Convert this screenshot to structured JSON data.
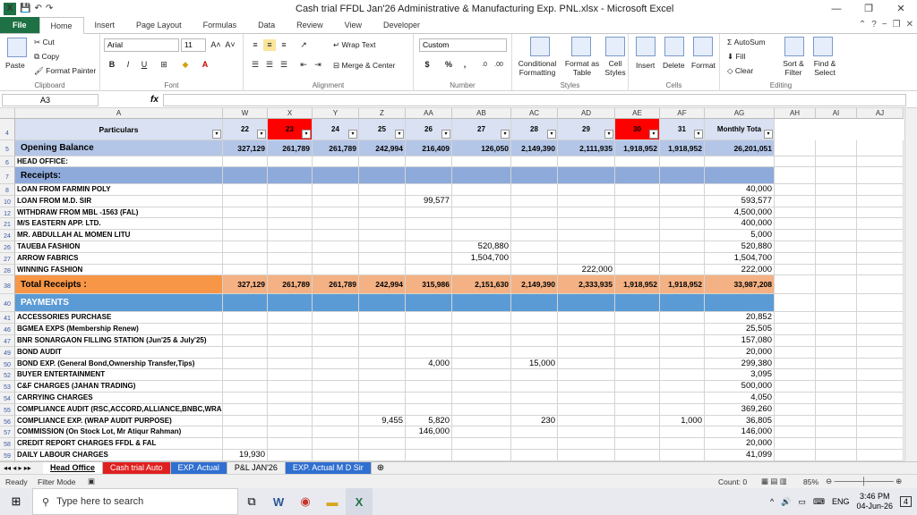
{
  "window": {
    "title": "Cash trial FFDL Jan'26 Administrative & Manufacturing Exp. PNL.xlsx  -  Microsoft Excel",
    "minimize": "—",
    "restore": "❐",
    "close": "✕"
  },
  "tabs": [
    "File",
    "Home",
    "Insert",
    "Page Layout",
    "Formulas",
    "Data",
    "Review",
    "View",
    "Developer"
  ],
  "ribbon": {
    "clipboard": {
      "paste": "Paste",
      "cut": "Cut",
      "copy": "Copy",
      "format_painter": "Format Painter",
      "label": "Clipboard"
    },
    "font": {
      "name": "Arial",
      "size": "11",
      "bold": "B",
      "italic": "I",
      "underline": "U",
      "grow": "A˄",
      "shrink": "A˅",
      "label": "Font"
    },
    "alignment": {
      "wrap": "Wrap Text",
      "merge": "Merge & Center",
      "label": "Alignment"
    },
    "number": {
      "format": "Custom",
      "currency": "$",
      "percent": "%",
      "comma": ",",
      "label": "Number"
    },
    "styles": {
      "cond": "Conditional Formatting",
      "table": "Format as Table",
      "cell": "Cell Styles",
      "label": "Styles"
    },
    "cells": {
      "insert": "Insert",
      "delete": "Delete",
      "format": "Format",
      "label": "Cells"
    },
    "editing": {
      "autosum": "AutoSum",
      "fill": "Fill",
      "clear": "Clear",
      "sort": "Sort & Filter",
      "find": "Find & Select",
      "label": "Editing"
    }
  },
  "formula_bar": {
    "name_box": "A3",
    "fx": "fx",
    "value": ""
  },
  "columns": [
    "A",
    "W",
    "X",
    "Y",
    "Z",
    "AA",
    "AB",
    "AC",
    "AD",
    "AE",
    "AF",
    "AG",
    "AH",
    "AI",
    "AJ"
  ],
  "header_row": {
    "row": "4",
    "particulars": "Particulars",
    "days": [
      "22",
      "23",
      "24",
      "25",
      "26",
      "27",
      "28",
      "29",
      "30",
      "31"
    ],
    "total": "Monthly Tota"
  },
  "rows": [
    {
      "r": "5",
      "label": "Opening Balance",
      "vals": [
        "327,129",
        "261,789",
        "261,789",
        "242,994",
        "216,409",
        "126,050",
        "2,149,390",
        "2,111,935",
        "1,918,952",
        "1,918,952"
      ],
      "total": "26,201,051",
      "style": "opening"
    },
    {
      "r": "6",
      "label": "HEAD OFFICE:",
      "vals": [
        "",
        "",
        "",
        "",
        "",
        "",
        "",
        "",
        "",
        ""
      ],
      "total": "",
      "style": "plainbold"
    },
    {
      "r": "7",
      "label": "Receipts:",
      "vals": [
        "",
        "",
        "",
        "",
        "",
        "",
        "",
        "",
        "",
        ""
      ],
      "total": "",
      "style": "section"
    },
    {
      "r": "8",
      "label": "LOAN FROM FARMIN POLY",
      "vals": [
        "",
        "",
        "",
        "",
        "",
        "",
        "",
        "",
        "",
        ""
      ],
      "total": "40,000",
      "style": "item"
    },
    {
      "r": "10",
      "label": "LOAN FROM M.D. SIR",
      "vals": [
        "",
        "",
        "",
        "",
        "99,577",
        "",
        "",
        "",
        "",
        ""
      ],
      "total": "593,577",
      "style": "item"
    },
    {
      "r": "12",
      "label": "WITHDRAW FROM MBL -1563 (FAL)",
      "vals": [
        "",
        "",
        "",
        "",
        "",
        "",
        "",
        "",
        "",
        ""
      ],
      "total": "4,500,000",
      "style": "item"
    },
    {
      "r": "21",
      "label": "M/S EASTERN APP. LTD.",
      "vals": [
        "",
        "",
        "",
        "",
        "",
        "",
        "",
        "",
        "",
        ""
      ],
      "total": "400,000",
      "style": "item"
    },
    {
      "r": "24",
      "label": "MR. ABDULLAH AL MOMEN LITU",
      "vals": [
        "",
        "",
        "",
        "",
        "",
        "",
        "",
        "",
        "",
        ""
      ],
      "total": "5,000",
      "style": "item"
    },
    {
      "r": "26",
      "label": "TAUEBA FASHION",
      "vals": [
        "",
        "",
        "",
        "",
        "",
        "520,880",
        "",
        "",
        "",
        ""
      ],
      "total": "520,880",
      "style": "item"
    },
    {
      "r": "27",
      "label": "ARROW FABRICS",
      "vals": [
        "",
        "",
        "",
        "",
        "",
        "1,504,700",
        "",
        "",
        "",
        ""
      ],
      "total": "1,504,700",
      "style": "item"
    },
    {
      "r": "28",
      "label": "WINNING FASHION",
      "vals": [
        "",
        "",
        "",
        "",
        "",
        "",
        "",
        "222,000",
        "",
        ""
      ],
      "total": "222,000",
      "style": "item"
    },
    {
      "r": "38",
      "label": "Total Receipts :",
      "vals": [
        "327,129",
        "261,789",
        "261,789",
        "242,994",
        "315,986",
        "2,151,630",
        "2,149,390",
        "2,333,935",
        "1,918,952",
        "1,918,952"
      ],
      "total": "33,987,208",
      "style": "total"
    },
    {
      "r": "40",
      "label": "PAYMENTS",
      "vals": [
        "",
        "",
        "",
        "",
        "",
        "",
        "",
        "",
        "",
        ""
      ],
      "total": "",
      "style": "payments"
    },
    {
      "r": "41",
      "label": "ACCESSORIES PURCHASE",
      "vals": [
        "",
        "",
        "",
        "",
        "",
        "",
        "",
        "",
        "",
        ""
      ],
      "total": "20,852",
      "style": "item"
    },
    {
      "r": "46",
      "label": "BGMEA EXPS (Membership Renew)",
      "vals": [
        "",
        "",
        "",
        "",
        "",
        "",
        "",
        "",
        "",
        ""
      ],
      "total": "25,505",
      "style": "item"
    },
    {
      "r": "47",
      "label": "BNR SONARGAON FILLING STATION (Jun'25 & July'25)",
      "vals": [
        "",
        "",
        "",
        "",
        "",
        "",
        "",
        "",
        "",
        ""
      ],
      "total": "157,080",
      "style": "item"
    },
    {
      "r": "49",
      "label": "BOND AUDIT",
      "vals": [
        "",
        "",
        "",
        "",
        "",
        "",
        "",
        "",
        "",
        ""
      ],
      "total": "20,000",
      "style": "item"
    },
    {
      "r": "50",
      "label": "BOND EXP. (General Bond,Ownership Transfer,Tips)",
      "vals": [
        "",
        "",
        "",
        "",
        "4,000",
        "",
        "15,000",
        "",
        "",
        ""
      ],
      "total": "299,380",
      "style": "item"
    },
    {
      "r": "52",
      "label": "BUYER ENTERTAINMENT",
      "vals": [
        "",
        "",
        "",
        "",
        "",
        "",
        "",
        "",
        "",
        ""
      ],
      "total": "3,095",
      "style": "item"
    },
    {
      "r": "53",
      "label": "C&F CHARGES (JAHAN TRADING)",
      "vals": [
        "",
        "",
        "",
        "",
        "",
        "",
        "",
        "",
        "",
        ""
      ],
      "total": "500,000",
      "style": "item"
    },
    {
      "r": "54",
      "label": "CARRYING CHARGES",
      "vals": [
        "",
        "",
        "",
        "",
        "",
        "",
        "",
        "",
        "",
        ""
      ],
      "total": "4,050",
      "style": "item"
    },
    {
      "r": "55",
      "label": "COMPLIANCE AUDIT (RSC,ACCORD,ALLIANCE,BNBC,WRAP)",
      "vals": [
        "",
        "",
        "",
        "",
        "",
        "",
        "",
        "",
        "",
        ""
      ],
      "total": "369,260",
      "style": "item"
    },
    {
      "r": "56",
      "label": "COMPLIANCE EXP. (WRAP AUDIT PURPOSE)",
      "vals": [
        "",
        "",
        "",
        "9,455",
        "5,820",
        "",
        "230",
        "",
        "",
        "1,000"
      ],
      "total": "36,805",
      "style": "item"
    },
    {
      "r": "57",
      "label": "COMMISSION (On Stock Lot, Mr Atiqur Rahman)",
      "vals": [
        "",
        "",
        "",
        "",
        "146,000",
        "",
        "",
        "",
        "",
        ""
      ],
      "total": "146,000",
      "style": "item"
    },
    {
      "r": "58",
      "label": "CREDIT REPORT CHARGES FFDL & FAL",
      "vals": [
        "",
        "",
        "",
        "",
        "",
        "",
        "",
        "",
        "",
        ""
      ],
      "total": "20,000",
      "style": "item"
    },
    {
      "r": "59",
      "label": "DAILY LABOUR CHARGES",
      "vals": [
        "19,930",
        "",
        "",
        "",
        "",
        "",
        "",
        "",
        "",
        ""
      ],
      "total": "41,099",
      "style": "item"
    }
  ],
  "sheet_tabs": [
    "Head Office",
    "Cash trial Auto",
    "EXP. Actual",
    "P&L JAN'26",
    "EXP. Actual M D Sir"
  ],
  "status": {
    "ready": "Ready",
    "filter": "Filter Mode",
    "count": "Count: 0",
    "zoom": "85%"
  },
  "taskbar": {
    "search": "Type here to search",
    "lang": "ENG",
    "time": "3:46 PM",
    "date": "04-Jun-26",
    "notif": "4"
  }
}
